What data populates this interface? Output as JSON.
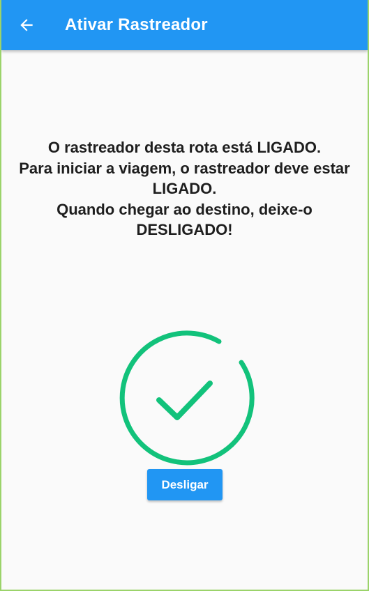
{
  "app_bar": {
    "title": "Ativar Rastreador",
    "back_icon": "arrow-back-icon",
    "background_color": "#2196F3"
  },
  "main": {
    "message_lines": [
      "O rastreador desta rota está LIGADO.",
      "Para iniciar a viagem, o rastreador deve estar LIGADO.",
      "Quando chegar ao destino, deixe-o DESLIGADO!"
    ],
    "status_icon": "check-circle-icon",
    "status_color": "#12C27B",
    "button_label": "Desligar"
  }
}
